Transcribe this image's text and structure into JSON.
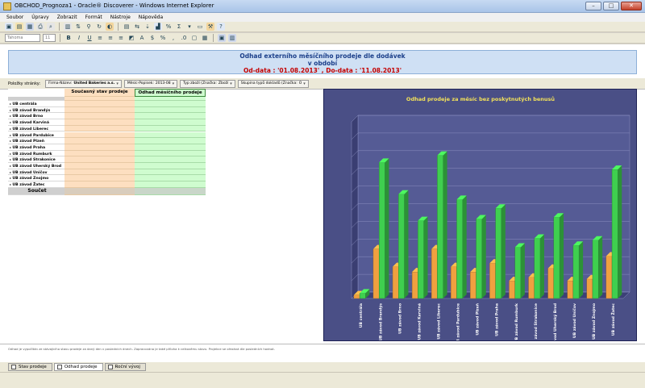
{
  "window": {
    "title": "OBCHOD_Prognoza1 - Oracle® Discoverer - Windows Internet Explorer"
  },
  "menu": [
    "Soubor",
    "Úpravy",
    "Zobrazit",
    "Formát",
    "Nástroje",
    "Nápověda"
  ],
  "toolbar2": {
    "font_value": "Tahoma",
    "size_value": "11"
  },
  "report": {
    "title_line1": "Odhad externího měsíčního prodeje dle dodávek",
    "title_line2": "v období",
    "title_line3": "Od-data : '01.08.2013' , Do-data : '11.08.2013'"
  },
  "page_items": {
    "label": "Položky stránky:",
    "items": [
      {
        "name": "Firma-Název:",
        "value": "United Bakeries a.s."
      },
      {
        "name": "Měsíc-Popisek:",
        "value": "2013-08"
      },
      {
        "name": "Typ zboží (Značka:",
        "value": "Zboží"
      },
      {
        "name": "Skupina typů dokladů (Značka:",
        "value": "O"
      }
    ]
  },
  "table": {
    "columns": [
      "Současný stav prodeje",
      "Odhad měsíčního prodeje"
    ],
    "rows": [
      {
        "label": "UB centrála"
      },
      {
        "label": "UB závod Brandýs"
      },
      {
        "label": "UB závod Brno"
      },
      {
        "label": "UB závod Karviná"
      },
      {
        "label": "UB závod Liberec"
      },
      {
        "label": "UB závod Pardubice"
      },
      {
        "label": "UB závod Plzeň"
      },
      {
        "label": "UB závod Praha"
      },
      {
        "label": "UB závod Rumburk"
      },
      {
        "label": "UB závod Strakonice"
      },
      {
        "label": "UB závod Uherský Brod"
      },
      {
        "label": "UB závod Uničov"
      },
      {
        "label": "UB závod Znojmo"
      },
      {
        "label": "UB závod Žatec"
      }
    ],
    "sum_label": "Součet"
  },
  "chart_data": {
    "type": "bar",
    "title": "Odhad prodeje za měsíc bez poskytnutých benusů",
    "categories": [
      "UB centrála",
      "UB závod Brandýs",
      "UB závod Brno",
      "UB závod Karviná",
      "UB závod Liberec",
      "UB závod Pardubice",
      "UB závod Plzeň",
      "UB závod Praha",
      "UB závod Rumburk",
      "UB závod Strakonice",
      "UB závod Uherský Brod",
      "UB závod Uničov",
      "UB závod Znojmo",
      "UB závod Žatec"
    ],
    "series": [
      {
        "color": "#f0a040",
        "values": [
          2,
          28,
          18,
          15,
          28,
          18,
          15,
          20,
          10,
          12,
          17,
          10,
          11,
          24
        ]
      },
      {
        "color": "#3fcf4f",
        "values": [
          3,
          77,
          59,
          44,
          81,
          56,
          45,
          51,
          29,
          34,
          46,
          30,
          33,
          73
        ]
      }
    ],
    "ylim": [
      0,
      100
    ],
    "grid": true,
    "legend": "none",
    "colors": {
      "background": "#4a4f86",
      "title": "#f2e15a",
      "grid": "#8a8fc0",
      "label": "#ffffff"
    }
  },
  "footnote": "Odhad je vypočítán ze stávajícího stavu prodeje za daný den v posledních dnech. Zapracována je také příloha k celkovému stavu. Projekce se ořezává dle posledních hodnot.",
  "sheet_tabs": [
    {
      "label": "Stav prodeje",
      "active": false
    },
    {
      "label": "Odhad prodeje",
      "active": true
    },
    {
      "label": "Roční vývoj",
      "active": false
    }
  ],
  "icons": [
    "new-icon",
    "open-icon",
    "save-icon",
    "print-icon",
    "bold-icon",
    "italic-icon",
    "underline-icon",
    "chart-icon",
    "table-icon"
  ]
}
